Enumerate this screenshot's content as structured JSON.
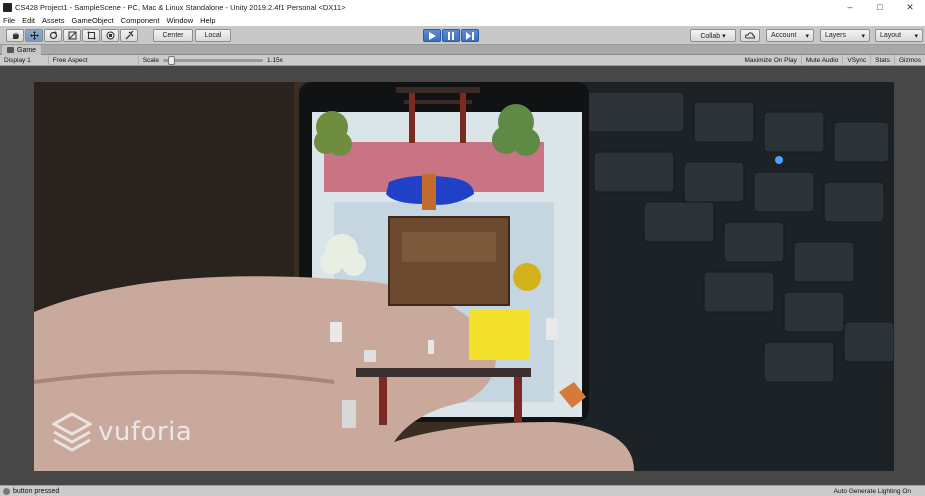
{
  "window": {
    "title": "CS428 Project1 - SampleScene - PC, Mac & Linux Standalone - Unity 2019.2.4f1 Personal <DX11>",
    "minimize": "–",
    "maximize": "□",
    "close": "✕"
  },
  "menu": [
    "File",
    "Edit",
    "Assets",
    "GameObject",
    "Component",
    "Window",
    "Help"
  ],
  "toolbar": {
    "pivot_label": "Center",
    "space_label": "Local",
    "collab_label": "Collab ▾",
    "account_label": "Account",
    "layers_label": "Layers",
    "layout_label": "Layout"
  },
  "game_tab": {
    "label": "Game"
  },
  "game_options": {
    "display": "Display 1",
    "aspect": "Free Aspect",
    "scale_label": "Scale",
    "scale_value": "1.15x",
    "scale_fraction": 0.05,
    "maximize_on_play": "Maximize On Play",
    "mute_audio": "Mute Audio",
    "vsync": "VSync",
    "stats": "Stats",
    "gizmos": "Gizmos"
  },
  "camera": {
    "watermark": "vuforia"
  },
  "status": {
    "message": "button pressed",
    "right": "Auto Generate Lighting On"
  },
  "colors": {
    "accent_play": "#4a7dcc",
    "toolbar_bg": "#c8c8c8"
  }
}
